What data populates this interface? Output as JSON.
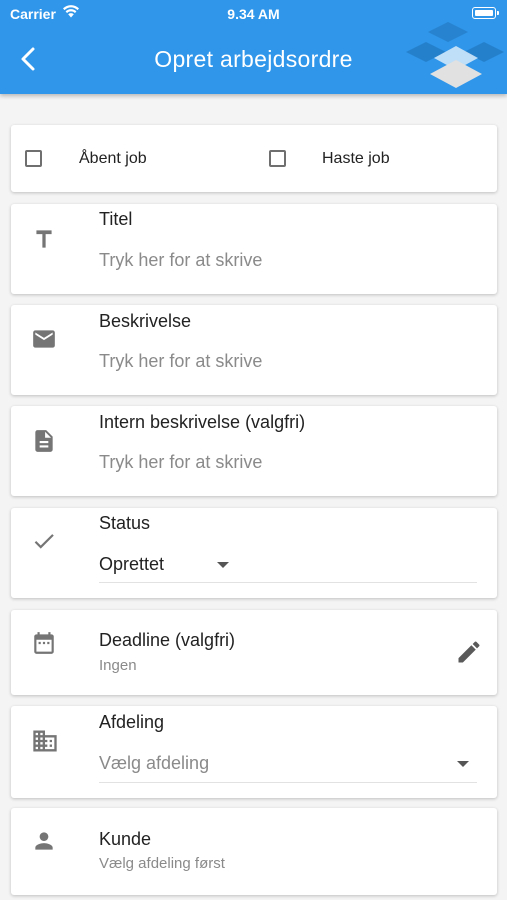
{
  "status_bar": {
    "carrier": "Carrier",
    "time": "9.34 AM"
  },
  "header": {
    "title": "Opret arbejdsordre"
  },
  "options": {
    "open_job_label": "Åbent job",
    "urgent_job_label": "Haste job"
  },
  "fields": {
    "title": {
      "label": "Titel",
      "placeholder": "Tryk her for at skrive"
    },
    "description": {
      "label": "Beskrivelse",
      "placeholder": "Tryk her for at skrive"
    },
    "internal_description": {
      "label": "Intern beskrivelse (valgfri)",
      "placeholder": "Tryk her for at skrive"
    },
    "status": {
      "label": "Status",
      "value": "Oprettet"
    },
    "deadline": {
      "label": "Deadline (valgfri)",
      "value": "Ingen"
    },
    "department": {
      "label": "Afdeling",
      "placeholder": "Vælg afdeling"
    },
    "customer": {
      "label": "Kunde",
      "value": "Vælg afdeling først"
    }
  },
  "colors": {
    "primary": "#2f96ea",
    "icon": "#757575",
    "placeholder": "#8a8a8a"
  }
}
